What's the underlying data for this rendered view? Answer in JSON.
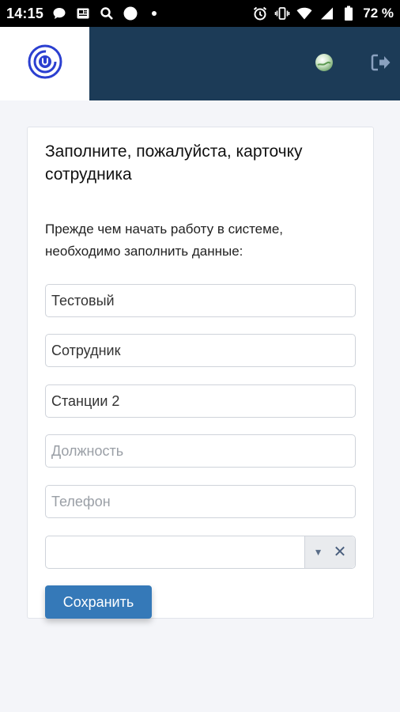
{
  "status_bar": {
    "time": "14:15",
    "battery": "72 %"
  },
  "header": {
    "logo_icon": "brand-logo-icon",
    "globe_icon": "globe-icon",
    "logout_icon": "logout-icon"
  },
  "card": {
    "title": "Заполните, пожалуйста, карточку сотрудника",
    "description": "Прежде чем начать работу в системе, необходимо заполнить данные:"
  },
  "form": {
    "first_name": {
      "value": "Тестовый"
    },
    "last_name": {
      "value": "Сотрудник"
    },
    "station": {
      "value": "Станции 2"
    },
    "position": {
      "value": "",
      "placeholder": "Должность"
    },
    "phone": {
      "value": "",
      "placeholder": "Телефон"
    },
    "select": {
      "value": ""
    },
    "save_label": "Сохранить"
  },
  "colors": {
    "header_bg": "#1c3b57",
    "primary_button": "#3579b8",
    "logo": "#2b3fd0"
  }
}
